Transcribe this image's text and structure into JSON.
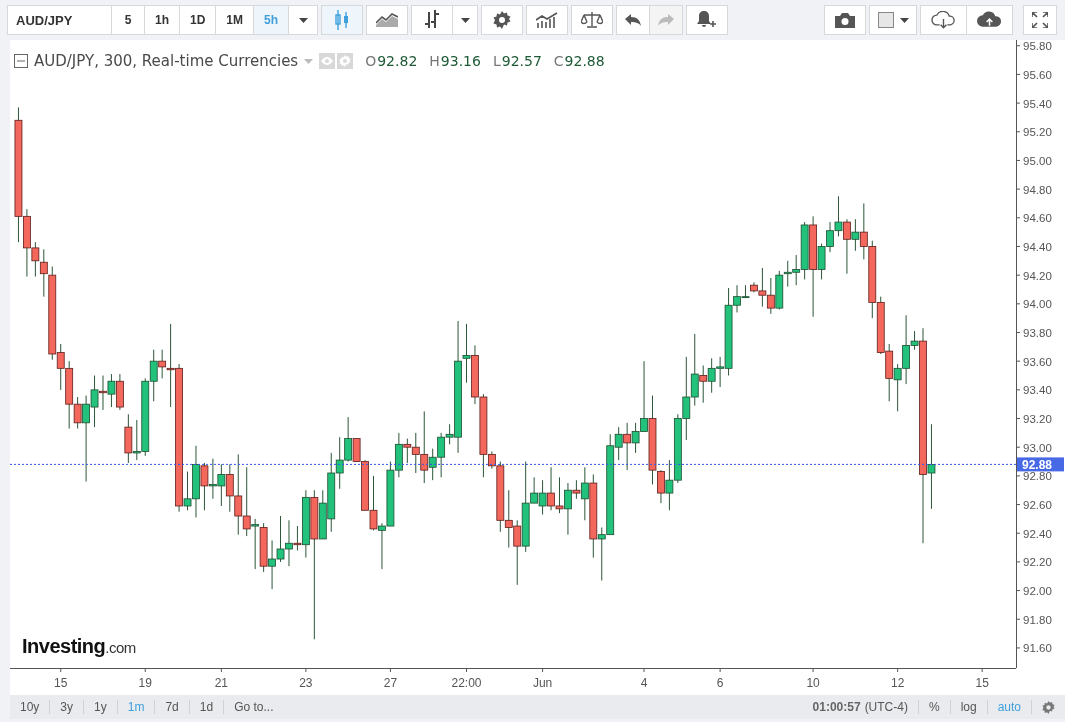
{
  "toolbar": {
    "symbol": "AUD/JPY",
    "intervals": [
      {
        "label": "5",
        "selected": false
      },
      {
        "label": "1h",
        "selected": false
      },
      {
        "label": "1D",
        "selected": false
      },
      {
        "label": "1M",
        "selected": false
      },
      {
        "label": "5h",
        "selected": true
      }
    ],
    "chart_styles": [
      {
        "kind": "candles",
        "selected": true
      },
      {
        "kind": "area",
        "selected": false
      },
      {
        "kind": "bars",
        "selected": false
      }
    ],
    "history": [
      {
        "kind": "undo",
        "disabled": false
      },
      {
        "kind": "redo",
        "disabled": true
      }
    ]
  },
  "legend": {
    "title": "AUD/JPY, 300, Real-time Currencies",
    "values": [
      {
        "label": "O",
        "value": "92.82"
      },
      {
        "label": "H",
        "value": "93.16"
      },
      {
        "label": "L",
        "value": "92.57"
      },
      {
        "label": "C",
        "value": "92.88"
      }
    ]
  },
  "logo": {
    "name": "Investing",
    "suffix": ".com"
  },
  "chart_data": {
    "type": "candlestick",
    "ylim": [
      91.46,
      95.84
    ],
    "categories": [
      null,
      null,
      null,
      null,
      null,
      "15",
      null,
      null,
      null,
      null,
      null,
      null,
      null,
      null,
      null,
      "19",
      null,
      null,
      null,
      null,
      null,
      null,
      null,
      null,
      "21",
      null,
      null,
      null,
      null,
      null,
      null,
      null,
      null,
      null,
      "23",
      null,
      null,
      null,
      null,
      null,
      null,
      null,
      null,
      null,
      "27",
      null,
      null,
      null,
      null,
      null,
      null,
      null,
      null,
      "22:00",
      null,
      null,
      null,
      null,
      null,
      null,
      null,
      null,
      "Jun",
      null,
      null,
      null,
      null,
      null,
      null,
      null,
      null,
      null,
      null,
      null,
      "4",
      null,
      null,
      null,
      null,
      null,
      null,
      null,
      null,
      "6",
      null,
      null,
      null,
      null,
      null,
      null,
      null,
      null,
      null,
      null,
      "10",
      null,
      null,
      null,
      null,
      null,
      null,
      null,
      null,
      null,
      "12",
      null,
      null,
      null,
      null,
      null,
      null,
      null,
      null,
      null,
      "15"
    ],
    "ohlc": [
      [
        95.28,
        95.37,
        94.43,
        94.61
      ],
      [
        94.61,
        94.66,
        94.19,
        94.39
      ],
      [
        94.39,
        94.43,
        94.19,
        94.3
      ],
      [
        94.29,
        94.38,
        94.05,
        94.21
      ],
      [
        94.2,
        94.26,
        93.61,
        93.65
      ],
      [
        93.66,
        93.72,
        93.4,
        93.55
      ],
      [
        93.55,
        93.6,
        93.13,
        93.3
      ],
      [
        93.3,
        93.35,
        93.13,
        93.17
      ],
      [
        93.17,
        93.36,
        92.76,
        93.3
      ],
      [
        93.28,
        93.5,
        93.14,
        93.4
      ],
      [
        93.39,
        93.5,
        93.26,
        93.38
      ],
      [
        93.37,
        93.51,
        93.28,
        93.46
      ],
      [
        93.46,
        93.51,
        93.26,
        93.28
      ],
      [
        93.14,
        93.23,
        92.89,
        92.96
      ],
      [
        92.96,
        93.19,
        92.91,
        92.97
      ],
      [
        92.97,
        93.48,
        92.94,
        93.46
      ],
      [
        93.46,
        93.68,
        93.32,
        93.6
      ],
      [
        93.6,
        93.68,
        93.48,
        93.56
      ],
      [
        93.55,
        93.86,
        93.28,
        93.54
      ],
      [
        93.55,
        93.58,
        92.55,
        92.59
      ],
      [
        92.59,
        92.83,
        92.56,
        92.64
      ],
      [
        92.64,
        93.01,
        92.51,
        92.88
      ],
      [
        92.87,
        92.89,
        92.56,
        92.73
      ],
      [
        92.73,
        92.92,
        92.64,
        92.74
      ],
      [
        92.73,
        92.88,
        92.59,
        92.81
      ],
      [
        92.81,
        92.88,
        92.55,
        92.66
      ],
      [
        92.66,
        92.95,
        92.39,
        92.52
      ],
      [
        92.52,
        92.86,
        92.38,
        92.43
      ],
      [
        92.45,
        92.5,
        92.15,
        92.46
      ],
      [
        92.44,
        92.47,
        92.13,
        92.17
      ],
      [
        92.17,
        92.35,
        92.01,
        92.22
      ],
      [
        92.22,
        92.52,
        92.2,
        92.29
      ],
      [
        92.29,
        92.49,
        92.17,
        92.33
      ],
      [
        92.33,
        92.45,
        92.28,
        92.32
      ],
      [
        92.32,
        92.7,
        92.23,
        92.65
      ],
      [
        92.65,
        92.7,
        91.66,
        92.36
      ],
      [
        92.36,
        92.7,
        92.36,
        92.61
      ],
      [
        92.5,
        92.96,
        92.41,
        92.82
      ],
      [
        92.82,
        93.07,
        92.71,
        92.91
      ],
      [
        92.91,
        93.21,
        92.9,
        93.06
      ],
      [
        93.06,
        93.06,
        92.9,
        92.9
      ],
      [
        92.9,
        92.91,
        92.56,
        92.56
      ],
      [
        92.56,
        92.8,
        92.42,
        92.43
      ],
      [
        92.42,
        92.47,
        92.15,
        92.45
      ],
      [
        92.45,
        92.9,
        92.45,
        92.84
      ],
      [
        92.84,
        93.1,
        92.79,
        93.02
      ],
      [
        93.02,
        93.06,
        92.89,
        93.0
      ],
      [
        93.0,
        93.1,
        92.82,
        92.95
      ],
      [
        92.95,
        93.25,
        92.75,
        92.84
      ],
      [
        92.86,
        92.99,
        92.77,
        92.93
      ],
      [
        92.93,
        93.1,
        92.79,
        93.07
      ],
      [
        93.07,
        93.16,
        93.02,
        93.09
      ],
      [
        93.07,
        93.88,
        92.96,
        93.6
      ],
      [
        93.62,
        93.86,
        93.45,
        93.64
      ],
      [
        93.64,
        93.71,
        93.3,
        93.35
      ],
      [
        93.35,
        93.37,
        92.79,
        92.95
      ],
      [
        92.95,
        92.97,
        92.85,
        92.87
      ],
      [
        92.87,
        92.9,
        92.41,
        92.49
      ],
      [
        92.49,
        92.7,
        92.3,
        92.44
      ],
      [
        92.45,
        92.49,
        92.04,
        92.31
      ],
      [
        92.31,
        92.9,
        92.27,
        92.61
      ],
      [
        92.61,
        92.79,
        92.61,
        92.68
      ],
      [
        92.59,
        92.77,
        92.53,
        92.68
      ],
      [
        92.68,
        92.86,
        92.56,
        92.59
      ],
      [
        92.59,
        92.79,
        92.54,
        92.57
      ],
      [
        92.57,
        92.75,
        92.39,
        92.7
      ],
      [
        92.7,
        92.77,
        92.64,
        92.68
      ],
      [
        92.64,
        92.86,
        92.49,
        92.75
      ],
      [
        92.75,
        92.81,
        92.23,
        92.36
      ],
      [
        92.36,
        92.44,
        92.07,
        92.39
      ],
      [
        92.39,
        93.09,
        92.39,
        93.01
      ],
      [
        93.0,
        93.14,
        92.91,
        93.09
      ],
      [
        93.09,
        93.17,
        92.84,
        93.03
      ],
      [
        93.03,
        93.17,
        92.96,
        93.11
      ],
      [
        93.11,
        93.6,
        93.11,
        93.2
      ],
      [
        93.2,
        93.36,
        92.74,
        92.84
      ],
      [
        92.83,
        92.84,
        92.61,
        92.68
      ],
      [
        92.68,
        92.91,
        92.56,
        92.77
      ],
      [
        92.77,
        93.23,
        92.75,
        93.2
      ],
      [
        93.2,
        93.63,
        93.05,
        93.35
      ],
      [
        93.35,
        93.79,
        93.29,
        93.51
      ],
      [
        93.5,
        93.57,
        93.31,
        93.46
      ],
      [
        93.46,
        93.62,
        93.38,
        93.55
      ],
      [
        93.55,
        93.63,
        93.42,
        93.56
      ],
      [
        93.55,
        94.11,
        93.5,
        93.99
      ],
      [
        93.99,
        94.13,
        93.94,
        94.05
      ],
      [
        94.05,
        94.13,
        94.04,
        94.05
      ],
      [
        94.13,
        94.15,
        94.08,
        94.09
      ],
      [
        94.09,
        94.25,
        93.98,
        94.06
      ],
      [
        94.06,
        94.18,
        93.93,
        93.97
      ],
      [
        93.97,
        94.23,
        93.96,
        94.2
      ],
      [
        94.21,
        94.3,
        94.12,
        94.22
      ],
      [
        94.22,
        94.34,
        94.13,
        94.24
      ],
      [
        94.24,
        94.57,
        94.17,
        94.55
      ],
      [
        94.55,
        94.61,
        93.91,
        94.24
      ],
      [
        94.24,
        94.42,
        94.17,
        94.4
      ],
      [
        94.4,
        94.57,
        94.36,
        94.51
      ],
      [
        94.51,
        94.75,
        94.47,
        94.57
      ],
      [
        94.57,
        94.59,
        94.21,
        94.45
      ],
      [
        94.45,
        94.59,
        94.37,
        94.5
      ],
      [
        94.5,
        94.7,
        94.31,
        94.4
      ],
      [
        94.4,
        94.44,
        93.9,
        94.01
      ],
      [
        94.01,
        94.05,
        93.65,
        93.66
      ],
      [
        93.67,
        93.72,
        93.32,
        93.48
      ],
      [
        93.47,
        93.58,
        93.25,
        93.55
      ],
      [
        93.55,
        93.92,
        93.44,
        93.71
      ],
      [
        93.71,
        93.81,
        93.68,
        93.74
      ],
      [
        93.74,
        93.83,
        92.33,
        92.81
      ],
      [
        92.82,
        93.16,
        92.57,
        92.88
      ],
      null,
      null,
      null,
      null,
      null,
      null
    ],
    "yticks": [
      {
        "value": 95.8,
        "label": "95.80"
      },
      {
        "value": 95.6,
        "label": "95.60"
      },
      {
        "value": 95.4,
        "label": "95.40"
      },
      {
        "value": 95.2,
        "label": "95.20"
      },
      {
        "value": 95.0,
        "label": "95.00"
      },
      {
        "value": 94.8,
        "label": "94.80"
      },
      {
        "value": 94.6,
        "label": "94.60"
      },
      {
        "value": 94.4,
        "label": "94.40"
      },
      {
        "value": 94.2,
        "label": "94.20"
      },
      {
        "value": 94.0,
        "label": "94.00"
      },
      {
        "value": 93.8,
        "label": "93.80"
      },
      {
        "value": 93.6,
        "label": "93.60"
      },
      {
        "value": 93.4,
        "label": "93.40"
      },
      {
        "value": 93.2,
        "label": "93.20"
      },
      {
        "value": 93.0,
        "label": "93.00"
      },
      {
        "value": 92.8,
        "label": "92.80"
      },
      {
        "value": 92.6,
        "label": "92.60"
      },
      {
        "value": 92.4,
        "label": "92.40"
      },
      {
        "value": 92.2,
        "label": "92.20"
      },
      {
        "value": 92.0,
        "label": "92.00"
      },
      {
        "value": 91.8,
        "label": "91.80"
      },
      {
        "value": 91.6,
        "label": "91.60"
      }
    ],
    "ref_lines": [
      {
        "axis": "y",
        "value": 92.88,
        "label": "92.88"
      }
    ]
  },
  "bottom_bar": {
    "ranges": [
      {
        "label": "10y",
        "selected": false
      },
      {
        "label": "3y",
        "selected": false
      },
      {
        "label": "1y",
        "selected": false
      },
      {
        "label": "1m",
        "selected": true
      },
      {
        "label": "7d",
        "selected": false
      },
      {
        "label": "1d",
        "selected": false
      }
    ],
    "goto": "Go to...",
    "time": "01:00:57",
    "timezone": "(UTC-4)",
    "toggles": [
      {
        "label": "%",
        "on": false
      },
      {
        "label": "log",
        "on": false
      },
      {
        "label": "auto",
        "on": true
      }
    ]
  }
}
